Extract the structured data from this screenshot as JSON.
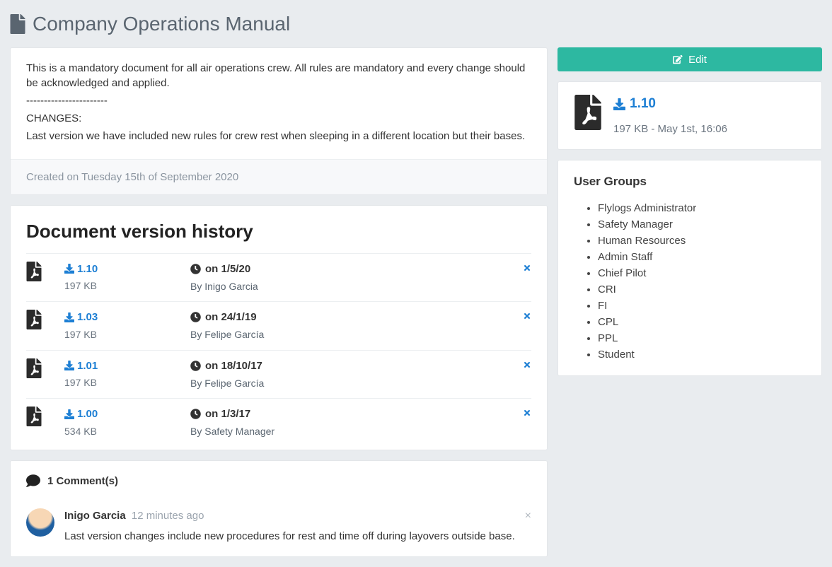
{
  "title": "Company Operations Manual",
  "description_lines": [
    "This is a mandatory document for all air operations crew. All rules are mandatory and every change should be acknowledged and applied.",
    "-----------------------",
    "CHANGES:",
    "Last version we have included new rules for crew rest when sleeping in a different location but their bases."
  ],
  "created_text": "Created on Tuesday 15th of September 2020",
  "history_title": "Document version history",
  "versions": [
    {
      "version": "1.10",
      "size": "197 KB",
      "date": "on 1/5/20",
      "by": "By Inigo Garcia"
    },
    {
      "version": "1.03",
      "size": "197 KB",
      "date": "on 24/1/19",
      "by": "By Felipe García"
    },
    {
      "version": "1.01",
      "size": "197 KB",
      "date": "on 18/10/17",
      "by": "By Felipe García"
    },
    {
      "version": "1.00",
      "size": "534 KB",
      "date": "on 1/3/17",
      "by": "By Safety Manager"
    }
  ],
  "comments_header": "1 Comment(s)",
  "comments": [
    {
      "author": "Inigo Garcia",
      "time": "12 minutes ago",
      "text": "Last version changes include new procedures for rest and time off during layovers outside base."
    }
  ],
  "edit_label": "Edit",
  "side_file": {
    "version": "1.10",
    "meta": "197 KB - May 1st, 16:06"
  },
  "user_groups_title": "User Groups",
  "user_groups": [
    "Flylogs Administrator",
    "Safety Manager",
    "Human Resources",
    "Admin Staff",
    "Chief Pilot",
    "CRI",
    "FI",
    "CPL",
    "PPL",
    "Student"
  ]
}
